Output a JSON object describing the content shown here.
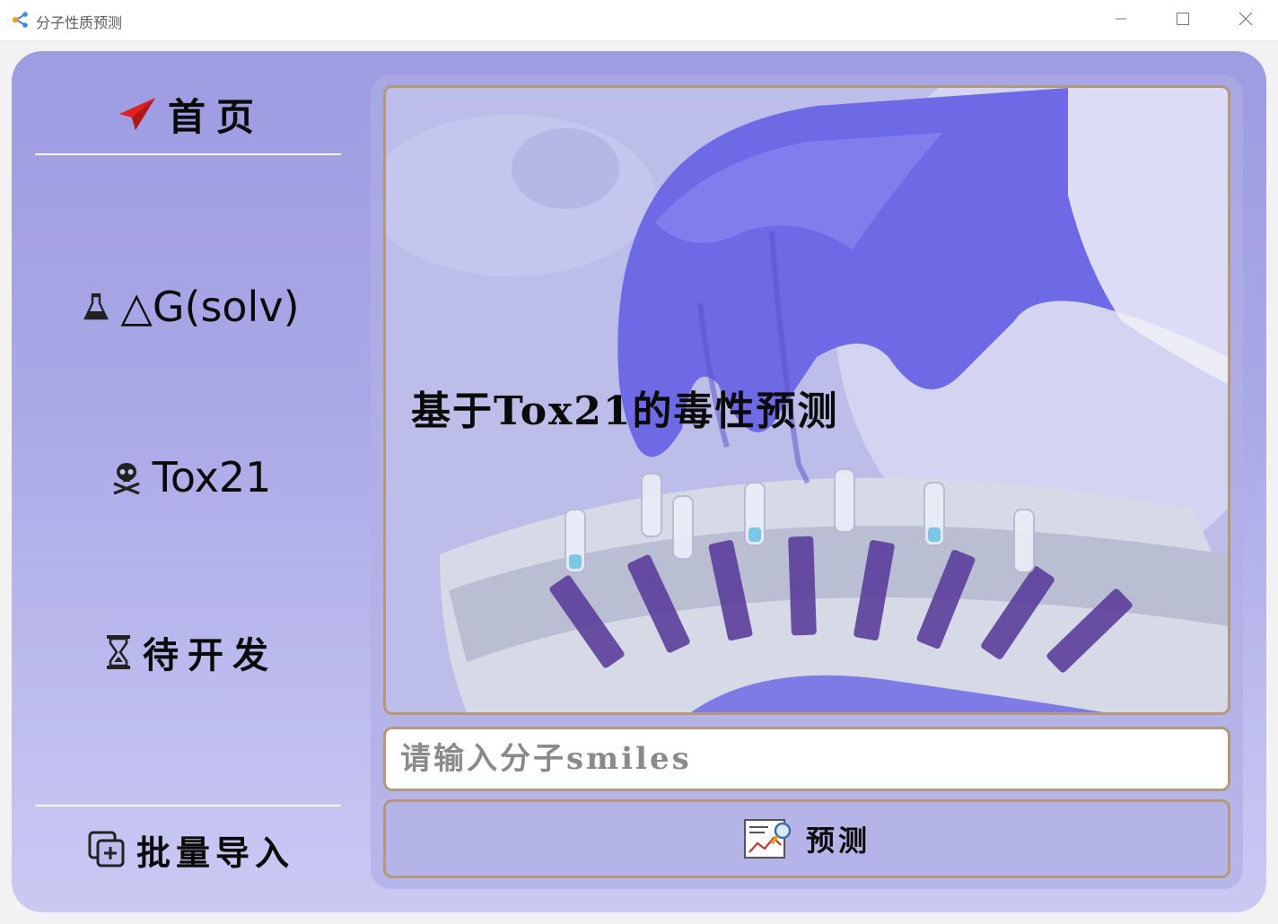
{
  "window": {
    "title": "分子性质预测",
    "icon": "app-molecule-icon",
    "minimize_icon": "minimize-icon",
    "maximize_icon": "maximize-icon",
    "close_icon": "close-icon"
  },
  "sidebar": {
    "home": {
      "label": "首页",
      "icon": "paper-plane-icon",
      "icon_color": "#e02020"
    },
    "items": [
      {
        "label": "△G(solv)",
        "icon": "flask-icon"
      },
      {
        "label": "Tox21",
        "icon": "skull-icon"
      },
      {
        "label": "待开发",
        "icon": "hourglass-icon"
      }
    ],
    "batch_import": {
      "label": "批量导入",
      "icon": "add-copy-icon"
    }
  },
  "main": {
    "hero_title": "基于Tox21的毒性预测",
    "hero_image": "lab-gloved-hand-test-tubes",
    "smiles_input": {
      "placeholder": "请输入分子smiles",
      "value": ""
    },
    "predict_button": {
      "label": "预测",
      "icon": "chart-search-icon"
    }
  },
  "colors": {
    "accent_border": "#b5977b",
    "card_background": "#a9a8e6",
    "glove": "#6e6ae6"
  }
}
